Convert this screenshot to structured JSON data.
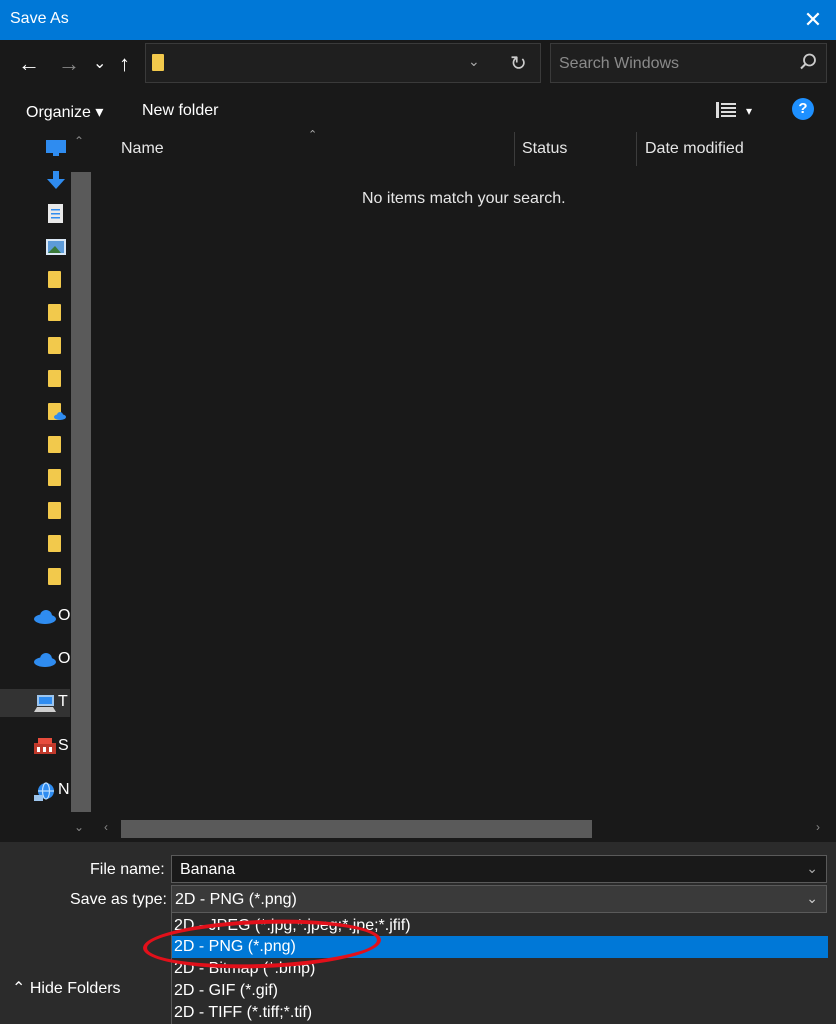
{
  "window": {
    "title": "Save As",
    "close": "✕"
  },
  "nav_buttons": {
    "back": "←",
    "forward": "→",
    "recent": "⌄",
    "up": "↑"
  },
  "address": {
    "dropdown": "⌄",
    "refresh": "↻"
  },
  "search": {
    "placeholder": "Search Windows"
  },
  "toolbar": {
    "organize": "Organize ▾",
    "new_folder": "New folder",
    "view_dd": "▾",
    "help": "?"
  },
  "sidebar": {
    "items": [
      {
        "icon": "desktop-icon",
        "label": ""
      },
      {
        "icon": "downloads-icon",
        "label": ""
      },
      {
        "icon": "documents-icon",
        "label": ""
      },
      {
        "icon": "pictures-icon",
        "label": ""
      },
      {
        "icon": "folder-icon",
        "label": ""
      },
      {
        "icon": "folder-icon",
        "label": ""
      },
      {
        "icon": "folder-icon",
        "label": ""
      },
      {
        "icon": "folder-icon",
        "label": ""
      },
      {
        "icon": "cloud-folder-icon",
        "label": ""
      },
      {
        "icon": "folder-icon",
        "label": ""
      },
      {
        "icon": "folder-icon",
        "label": ""
      },
      {
        "icon": "folder-icon",
        "label": ""
      },
      {
        "icon": "folder-icon",
        "label": ""
      },
      {
        "icon": "folder-icon",
        "label": ""
      },
      {
        "icon": "onedrive-icon",
        "label": "O"
      },
      {
        "icon": "onedrive-icon",
        "label": "O"
      },
      {
        "icon": "this-pc-icon",
        "label": "T"
      },
      {
        "icon": "drive-icon",
        "label": "S"
      },
      {
        "icon": "network-icon",
        "label": "N"
      }
    ]
  },
  "file_list": {
    "columns": [
      "Name",
      "Status",
      "Date modified"
    ],
    "empty_message": "No items match your search."
  },
  "form": {
    "file_name_label": "File name:",
    "file_name_value": "Banana",
    "save_type_label": "Save as type:",
    "save_type_value": "2D - PNG (*.png)"
  },
  "type_options": [
    "2D - JPEG (*.jpg;*.jpeg;*.jpe;*.jfif)",
    "2D - PNG (*.png)",
    "2D - Bitmap (*.bmp)",
    "2D - GIF (*.gif)",
    "2D - TIFF (*.tiff;*.tif)"
  ],
  "hide_folders": "⌃ Hide Folders",
  "colors": {
    "accent": "#0078d7",
    "annotation": "#e2101a",
    "folder": "#f2c94c"
  }
}
